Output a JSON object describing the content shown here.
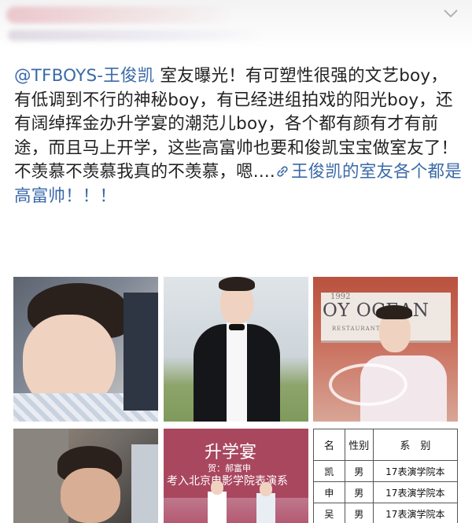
{
  "header": {
    "collapse_icon": "chevron-down-icon"
  },
  "post": {
    "mention": "@TFBOYS-王俊凯",
    "body": " 室友曝光！有可塑性很强的文艺boy，有低调到不行的神秘boy，有已经进组拍戏的阳光boy，还有阔绰挥金办升学宴的潮范儿boy，各个都有颜有才有前途，而且马上开学，这些高富帅也要和俊凯宝宝做室友了！不羡慕不羡慕我真的不羡慕，嗯....",
    "link_icon": "link-icon",
    "link_text": "王俊凯的室友各个都是高富帅！！！"
  },
  "photos": {
    "photo3": {
      "sign_year": "1992",
      "sign_text": "OY OCEAN",
      "sign_sub": "RESTAURANT"
    },
    "photo5": {
      "title": "升学宴",
      "line1": "贺：郝富申",
      "line2": "考入北京电影学院表演系"
    },
    "photo6": {
      "headers": [
        "名",
        "性别",
        "系　别"
      ],
      "rows": [
        [
          "凯",
          "男",
          "17表演学院本"
        ],
        [
          "申",
          "男",
          "17表演学院本"
        ],
        [
          "吴",
          "男",
          "17表演学院本"
        ]
      ]
    }
  }
}
